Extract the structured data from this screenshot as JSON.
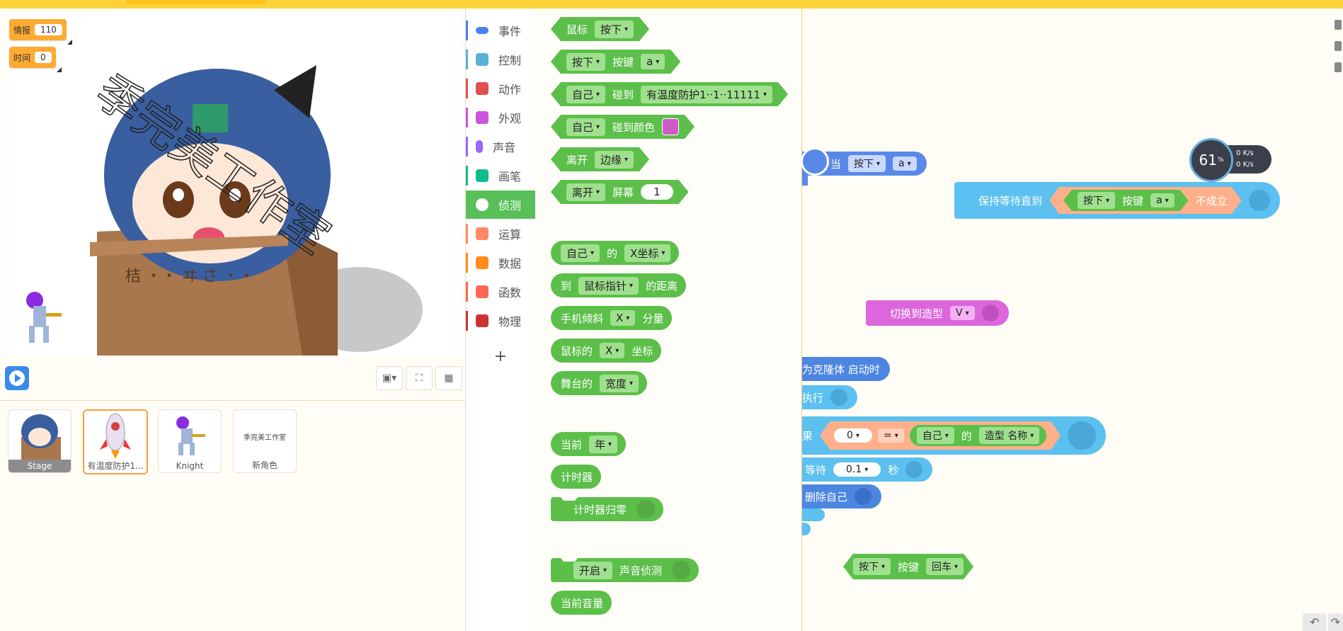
{
  "stage": {
    "monitors": [
      {
        "label": "情报",
        "value": "110"
      },
      {
        "label": "时间",
        "value": "0"
      }
    ],
    "watermark": "季完美工作室"
  },
  "sprites": [
    {
      "name": "Stage"
    },
    {
      "name": "有温度防护1..."
    },
    {
      "name": "Knight"
    },
    {
      "name": "新角色",
      "thumb_text": "季完美工作室"
    }
  ],
  "categories": [
    {
      "label": "事件",
      "color": "#4c7ff0"
    },
    {
      "label": "控制",
      "color": "#5cb1d6"
    },
    {
      "label": "动作",
      "color": "#e05050"
    },
    {
      "label": "外观",
      "color": "#cc55dd"
    },
    {
      "label": "声音",
      "color": "#9966ff"
    },
    {
      "label": "画笔",
      "color": "#0fbd8c"
    },
    {
      "label": "侦测",
      "color": "#59c059"
    },
    {
      "label": "运算",
      "color": "#ff8866"
    },
    {
      "label": "数据",
      "color": "#ff8c1a"
    },
    {
      "label": "函数",
      "color": "#ff6655"
    },
    {
      "label": "物理",
      "color": "#cc3333"
    }
  ],
  "add_category": "+",
  "palette": {
    "b1": {
      "t1": "鼠标",
      "d1": "按下"
    },
    "b2": {
      "d1": "按下",
      "t1": "按键",
      "d2": "a"
    },
    "b3": {
      "d1": "自己",
      "t1": "碰到",
      "d2": "有温度防护1··1··11111"
    },
    "b4": {
      "d1": "自己",
      "t1": "碰到颜色"
    },
    "b5": {
      "t1": "离开",
      "d1": "边缘"
    },
    "b6": {
      "d1": "离开",
      "t1": "屏幕",
      "v1": "1"
    },
    "b7": {
      "d1": "自己",
      "t1": "的",
      "d2": "X坐标"
    },
    "b8": {
      "t1": "到",
      "d1": "鼠标指针",
      "t2": "的距离"
    },
    "b9": {
      "t1": "手机倾斜",
      "d1": "X",
      "t2": "分量"
    },
    "b10": {
      "t1": "鼠标的",
      "d1": "X",
      "t2": "坐标"
    },
    "b11": {
      "t1": "舞台的",
      "d1": "宽度"
    },
    "b12": {
      "t1": "当前",
      "d1": "年"
    },
    "b13": {
      "t1": "计时器"
    },
    "b14": {
      "t1": "计时器归零"
    },
    "b15": {
      "d1": "开启",
      "t1": "声音侦测"
    },
    "b16": {
      "t1": "当前音量"
    }
  },
  "workspace": {
    "w1": {
      "t1": "当",
      "d1": "按下",
      "d2": "a"
    },
    "w2": {
      "t1": "保持等待直到",
      "d1": "按下",
      "t2": "按键",
      "d2": "a",
      "t3": "不成立"
    },
    "w3": {
      "t1": "切换到造型",
      "d1": "V"
    },
    "w4": {
      "t1": "为克隆体 启动时"
    },
    "w5": {
      "t1": "执行"
    },
    "w6": {
      "t1": "果",
      "v1": "0",
      "op": "=",
      "d1": "自己",
      "t2": "的",
      "d2": "造型 名称"
    },
    "w7": {
      "t1": "等待",
      "v1": "0.1",
      "t2": "秒"
    },
    "w8": {
      "t1": "删除自己"
    },
    "w9": {
      "d1": "按下",
      "t1": "按键",
      "d2": "回车"
    }
  },
  "net_speed": {
    "cpu": "61",
    "cpu_unit": "%",
    "up": "0",
    "down": "0",
    "unit": "K/s"
  }
}
